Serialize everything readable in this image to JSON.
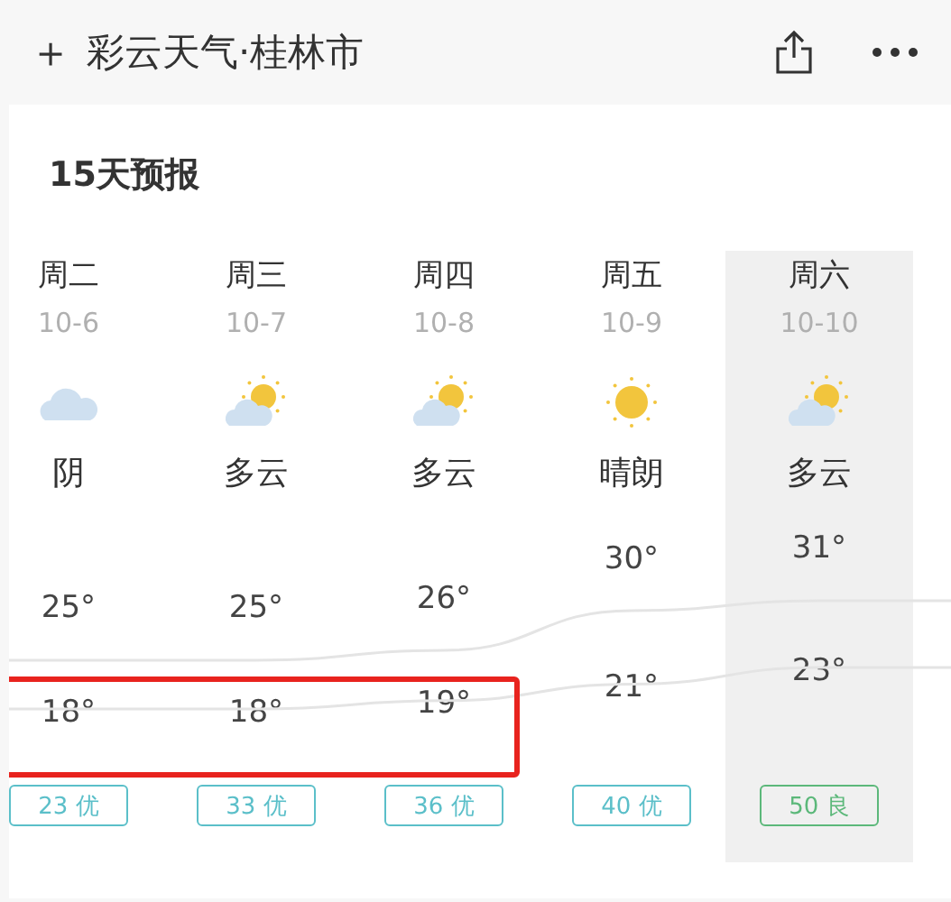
{
  "header": {
    "add_icon": "＋",
    "title": "彩云天气·桂林市"
  },
  "card": {
    "title": "15天预报"
  },
  "days": [
    {
      "weekday": "周二",
      "date": "10-6",
      "kind": "cloudy",
      "condition": "阴",
      "high": "25°",
      "low": "18°",
      "aqi": "23 优",
      "color": "#5bbfc9",
      "selected": false,
      "boxed": true
    },
    {
      "weekday": "周三",
      "date": "10-7",
      "kind": "partly_cloudy",
      "condition": "多云",
      "high": "25°",
      "low": "18°",
      "aqi": "33 优",
      "color": "#5bbfc9",
      "selected": false,
      "boxed": true
    },
    {
      "weekday": "周四",
      "date": "10-8",
      "kind": "partly_cloudy",
      "condition": "多云",
      "high": "26°",
      "low": "19°",
      "aqi": "36 优",
      "color": "#5bbfc9",
      "selected": false,
      "boxed": true
    },
    {
      "weekday": "周五",
      "date": "10-9",
      "kind": "sunny",
      "condition": "晴朗",
      "high": "30°",
      "low": "21°",
      "aqi": "40 优",
      "color": "#5bbfc9",
      "selected": false,
      "boxed": false
    },
    {
      "weekday": "周六",
      "date": "10-10",
      "kind": "partly_cloudy",
      "condition": "多云",
      "high": "31°",
      "low": "23°",
      "aqi": "50 良",
      "color": "#5cb87a",
      "selected": true,
      "boxed": false
    }
  ]
}
